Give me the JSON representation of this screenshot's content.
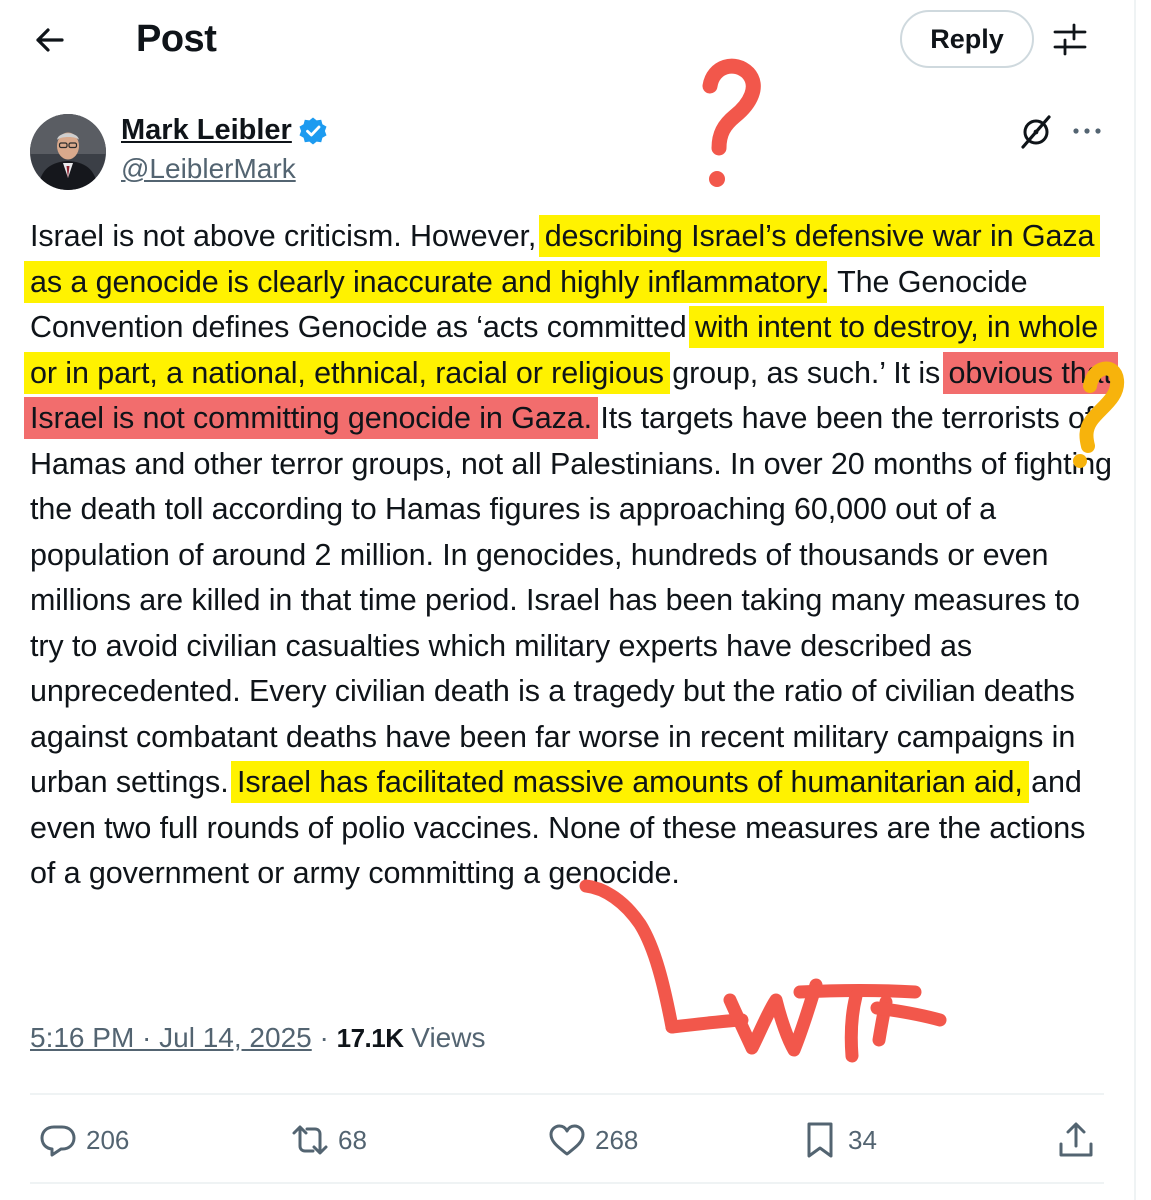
{
  "header": {
    "title": "Post",
    "reply_label": "Reply"
  },
  "author": {
    "name": "Mark Leibler",
    "handle": "@LeiblerMark"
  },
  "post": {
    "segments": [
      {
        "text": "Israel is not above criticism. However, ",
        "hl": ""
      },
      {
        "text": "describing Israel’s defensive war in Gaza as a genocide is clearly inaccurate and highly inflammatory",
        "hl": "y"
      },
      {
        "text": ". The Genocide Convention defines Genocide as ‘acts committed ",
        "hl": ""
      },
      {
        "text": "with intent to destroy, in whole or in part, a national, ethnical, racial or religious",
        "hl": "y"
      },
      {
        "text": " group, as such.’ It is ",
        "hl": ""
      },
      {
        "text": "obvious that Israel is not committing genocide in Gaza.",
        "hl": "r"
      },
      {
        "text": " Its targets have been the terrorists of Hamas and other terror groups, not all Palestinians. In over 20 months of fighting the death toll according to Hamas figures is approaching 60,000 out of a population of around 2 million. In genocides, hundreds of thousands or even millions are killed in that time period. Israel has been taking many measures to try to avoid civilian casualties which military experts have described as unprecedented. Every civilian death is a tragedy but the ratio of civilian deaths against combatant deaths have been far worse in recent military campaigns in urban settings. ",
        "hl": ""
      },
      {
        "text": "Israel has facilitated massive amounts of humanitarian aid,",
        "hl": "y"
      },
      {
        "text": " and even two full rounds of polio vaccines. None of these measures are the actions of a government or army committing a genocide.",
        "hl": ""
      }
    ]
  },
  "meta": {
    "time": "5:16 PM · Jul 14, 2025",
    "sep": " · ",
    "views_count": "17.1K",
    "views_label": " Views"
  },
  "actions": {
    "replies": "206",
    "reposts": "68",
    "likes": "268",
    "bookmarks": "34"
  },
  "annotations": {
    "handwritten": "WTF"
  },
  "colors": {
    "highlight_yellow": "#fff200",
    "highlight_red": "#f26d6d",
    "annotation_red": "#f2574b",
    "annotation_orange": "#f7b30c",
    "verified_blue": "#1d9bf0"
  },
  "icons": [
    "back-arrow-icon",
    "tune-icon",
    "verified-badge-icon",
    "grok-icon",
    "more-icon",
    "reply-icon",
    "repost-icon",
    "like-icon",
    "bookmark-icon",
    "share-icon"
  ]
}
